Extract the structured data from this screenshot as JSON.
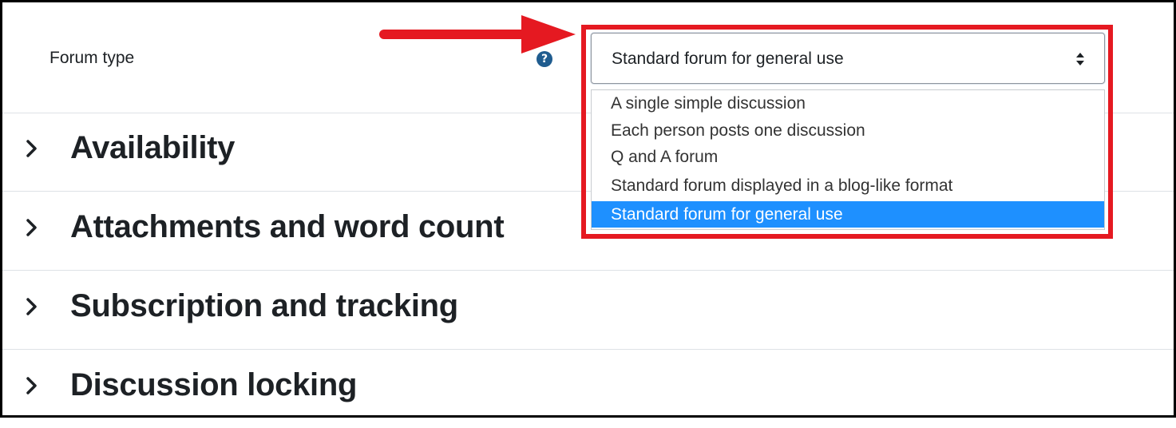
{
  "forum_type": {
    "label": "Forum type",
    "help_icon": "question-circle-icon",
    "selected_value": "Standard forum for general use",
    "options": [
      "A single simple discussion",
      "Each person posts one discussion",
      "Q and A forum",
      "Standard forum displayed in a blog-like format",
      "Standard forum for general use"
    ],
    "selected_index": 4
  },
  "sections": [
    {
      "title": "Availability",
      "icon": "chevron-right-icon"
    },
    {
      "title": "Attachments and word count",
      "icon": "chevron-right-icon"
    },
    {
      "title": "Subscription and tracking",
      "icon": "chevron-right-icon"
    },
    {
      "title": "Discussion locking",
      "icon": "chevron-right-icon"
    }
  ],
  "colors": {
    "annotation_red": "#e51921",
    "selected_option_bg": "#1e90ff",
    "help_icon_bg": "#1f5c8f"
  }
}
